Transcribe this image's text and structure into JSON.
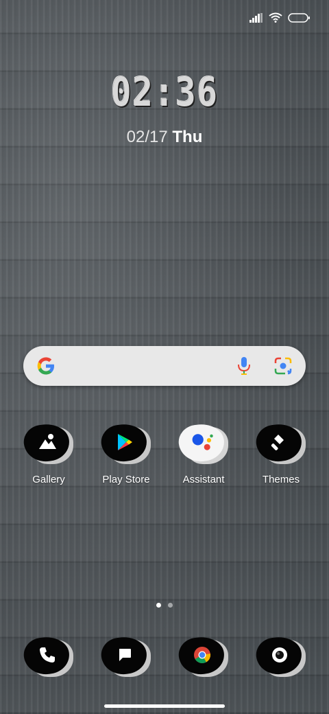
{
  "clock": {
    "time": "02:36"
  },
  "date": {
    "date_text": "02/17",
    "weekday": "Thu"
  },
  "status_bar": {
    "signal": "signal-icon",
    "wifi": "wifi-icon",
    "battery": "battery-icon"
  },
  "search": {
    "logo": "google-g-icon",
    "mic": "mic-icon",
    "lens": "lens-icon"
  },
  "home_apps": [
    {
      "label": "Gallery",
      "icon": "gallery-icon"
    },
    {
      "label": "Play Store",
      "icon": "play-store-icon"
    },
    {
      "label": "Assistant",
      "icon": "assistant-icon"
    },
    {
      "label": "Themes",
      "icon": "themes-icon"
    }
  ],
  "dock_apps": [
    {
      "icon": "phone-icon"
    },
    {
      "icon": "messages-icon"
    },
    {
      "icon": "chrome-icon"
    },
    {
      "icon": "camera-icon"
    }
  ],
  "page_indicator": {
    "pages": 2,
    "current": 1
  },
  "colors": {
    "wallpaper": "#52575b",
    "search_bar": "#e8e8e8",
    "icon_blob": "#050505"
  }
}
